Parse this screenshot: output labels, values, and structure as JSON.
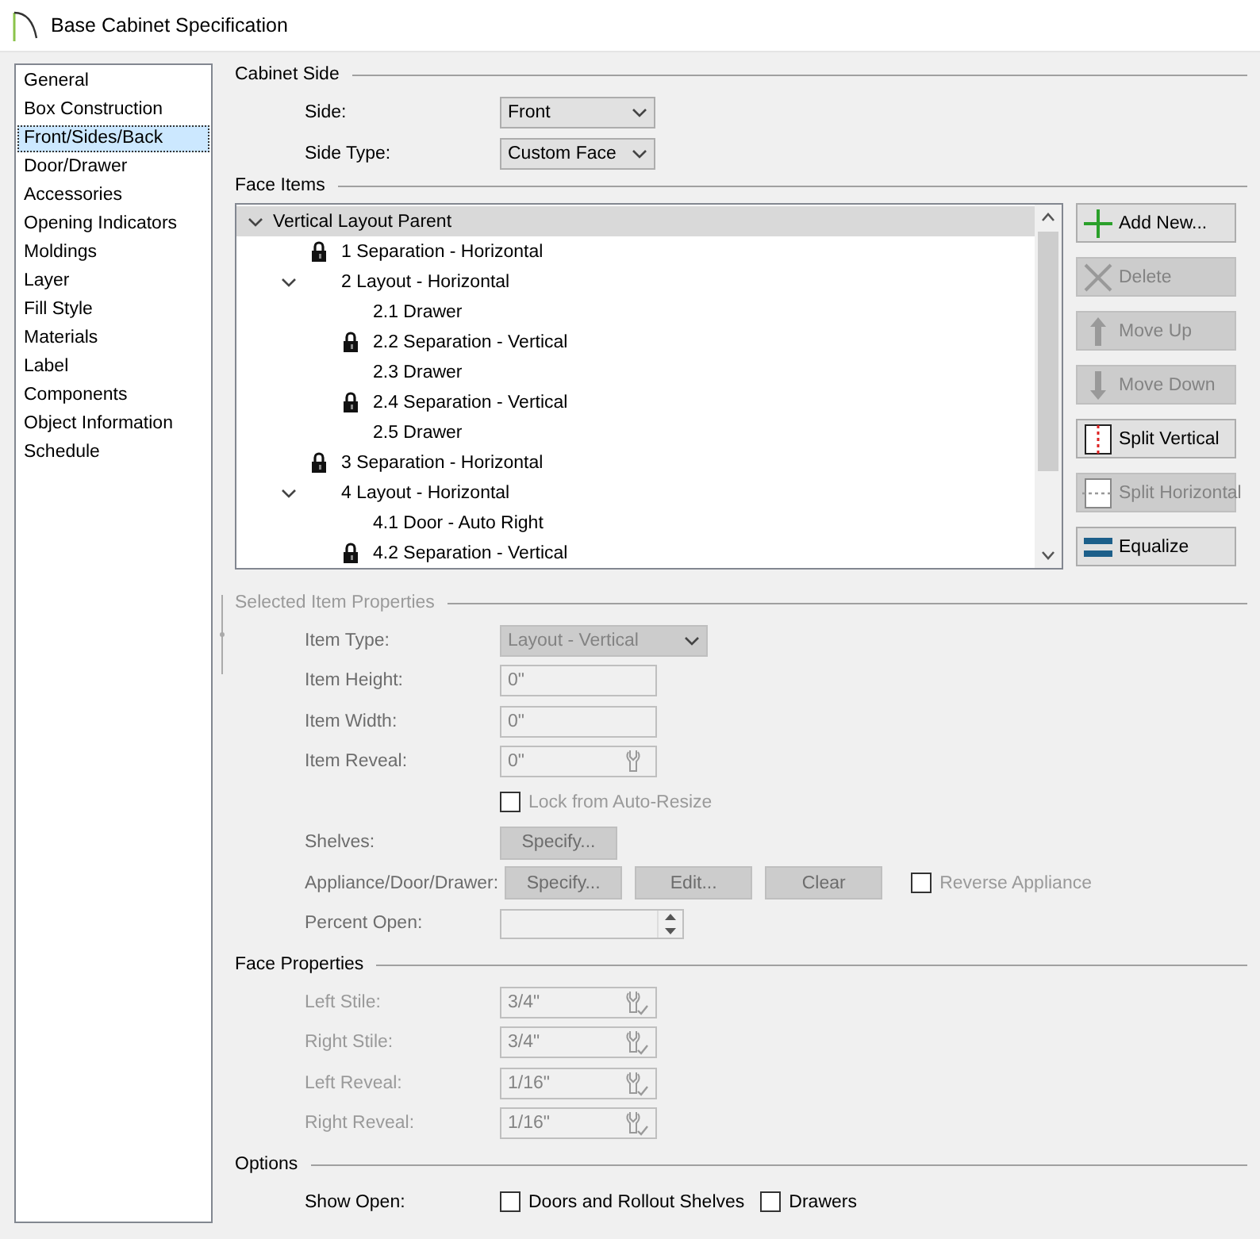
{
  "window": {
    "title": "Base Cabinet Specification"
  },
  "sidebar": {
    "items": [
      {
        "label": "General",
        "selected": false
      },
      {
        "label": "Box Construction",
        "selected": false
      },
      {
        "label": "Front/Sides/Back",
        "selected": true
      },
      {
        "label": "Door/Drawer",
        "selected": false
      },
      {
        "label": "Accessories",
        "selected": false
      },
      {
        "label": "Opening Indicators",
        "selected": false
      },
      {
        "label": "Moldings",
        "selected": false
      },
      {
        "label": "Layer",
        "selected": false
      },
      {
        "label": "Fill Style",
        "selected": false
      },
      {
        "label": "Materials",
        "selected": false
      },
      {
        "label": "Label",
        "selected": false
      },
      {
        "label": "Components",
        "selected": false
      },
      {
        "label": "Object Information",
        "selected": false
      },
      {
        "label": "Schedule",
        "selected": false
      }
    ]
  },
  "cabinet_side": {
    "title": "Cabinet Side",
    "rows": [
      {
        "label": "Side:",
        "value": "Front"
      },
      {
        "label": "Side Type:",
        "value": "Custom Face"
      }
    ]
  },
  "face_items": {
    "title": "Face Items",
    "tree": [
      {
        "label": "Vertical Layout Parent",
        "expanded": true,
        "selected": true,
        "children": [
          {
            "label": "1 Separation - Horizontal",
            "locked": true,
            "selected": false
          },
          {
            "label": "2 Layout - Horizontal",
            "locked": false,
            "expanded": true,
            "selected": false,
            "children": [
              {
                "label": "2.1 Drawer",
                "locked": false,
                "selected": false
              },
              {
                "label": "2.2 Separation - Vertical",
                "locked": true,
                "selected": false
              },
              {
                "label": "2.3 Drawer",
                "locked": false,
                "selected": false
              },
              {
                "label": "2.4 Separation - Vertical",
                "locked": true,
                "selected": false
              },
              {
                "label": "2.5 Drawer",
                "locked": false,
                "selected": false
              }
            ]
          },
          {
            "label": "3 Separation - Horizontal",
            "locked": true,
            "selected": false
          },
          {
            "label": "4 Layout - Horizontal",
            "locked": false,
            "expanded": true,
            "selected": false,
            "children": [
              {
                "label": "4.1 Door - Auto Right",
                "locked": false,
                "selected": false
              },
              {
                "label": "4.2 Separation - Vertical",
                "locked": true,
                "selected": false
              }
            ]
          }
        ]
      }
    ],
    "buttons": [
      {
        "label": "Add New...",
        "disabled": false
      },
      {
        "label": "Delete",
        "disabled": true
      },
      {
        "label": "Move Up",
        "disabled": true
      },
      {
        "label": "Move Down",
        "disabled": true
      },
      {
        "label": "Split Vertical",
        "disabled": false
      },
      {
        "label": "Split Horizontal",
        "disabled": true
      },
      {
        "label": "Equalize",
        "disabled": false
      }
    ]
  },
  "selected_item_properties": {
    "title": "Selected Item Properties",
    "disabled": true,
    "rows": [
      {
        "kind": "select",
        "label": "Item Type:",
        "value": "Layout - Vertical"
      },
      {
        "kind": "text",
        "label": "Item Height:",
        "value": "0\""
      },
      {
        "kind": "text",
        "label": "Item Width:",
        "value": "0\""
      },
      {
        "kind": "wrench",
        "label": "Item Reveal:",
        "value": "0\""
      },
      {
        "kind": "checkbox",
        "text": "Lock from Auto-Resize",
        "checked": false
      },
      {
        "kind": "buttons",
        "label": "Shelves:",
        "buttons": [
          "Specify..."
        ]
      },
      {
        "kind": "buttons",
        "label": "Appliance/Door/Drawer:",
        "buttons": [
          "Specify...",
          "Edit...",
          "Clear"
        ],
        "checkbox": {
          "text": "Reverse Appliance",
          "checked": false
        }
      },
      {
        "kind": "spin",
        "label": "Percent Open:"
      }
    ]
  },
  "face_properties": {
    "title": "Face Properties",
    "disabled": true,
    "rows": [
      {
        "kind": "wrench-check",
        "label": "Left Stile:",
        "value": "3/4\""
      },
      {
        "kind": "wrench-check",
        "label": "Right Stile:",
        "value": "3/4\""
      },
      {
        "kind": "wrench-check",
        "label": "Left Reveal:",
        "value": "1/16\""
      },
      {
        "kind": "wrench-check",
        "label": "Right Reveal:",
        "value": "1/16\""
      }
    ]
  },
  "options": {
    "title": "Options",
    "label": "Show Open:",
    "checkboxes": [
      {
        "text": "Doors and Rollout Shelves",
        "checked": false
      },
      {
        "text": "Drawers",
        "checked": false
      }
    ]
  }
}
